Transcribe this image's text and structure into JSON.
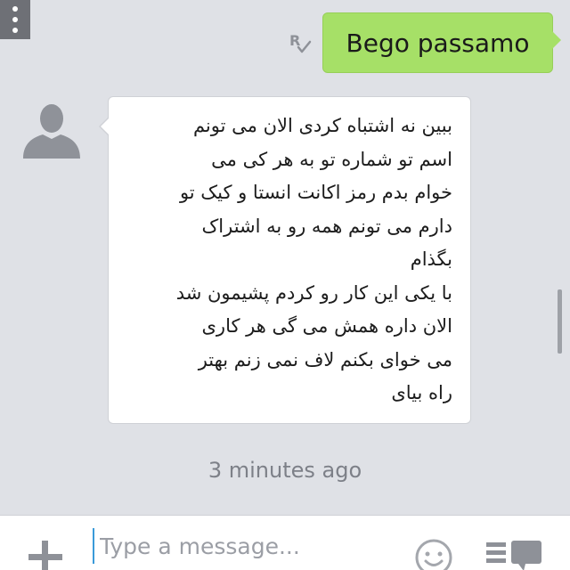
{
  "header": {
    "menu_icon": "vertical-dots-icon"
  },
  "messages": {
    "sent": {
      "text": "Bego passamo",
      "status_icon": "read-receipt-icon"
    },
    "received": {
      "avatar_icon": "default-user-avatar-icon",
      "lines": [
        "ببین نه اشتباه کردی الان می تونم",
        "اسم تو شماره تو به هر کی می",
        "خوام بدم رمز اکانت انستا و کیک تو",
        "دارم می تونم همه رو به اشتراک",
        "بگذام",
        "با یکی این کار رو کردم پشیمون شد",
        "الان داره همش می گی هر کاری",
        "می خوای بکنم لاف نمی زنم بهتر",
        "راه بیای"
      ]
    },
    "timestamp": "3 minutes ago"
  },
  "composer": {
    "placeholder": "Type a message...",
    "value": "",
    "add_icon": "plus-icon",
    "emoji_icon": "emoji-icon",
    "sticker_icon": "sticker-icon"
  },
  "colors": {
    "background": "#dfe1e6",
    "sent_bubble": "#a6e067",
    "received_bubble": "#ffffff",
    "timestamp": "#7d8088",
    "icon_gray": "#8e9198"
  }
}
